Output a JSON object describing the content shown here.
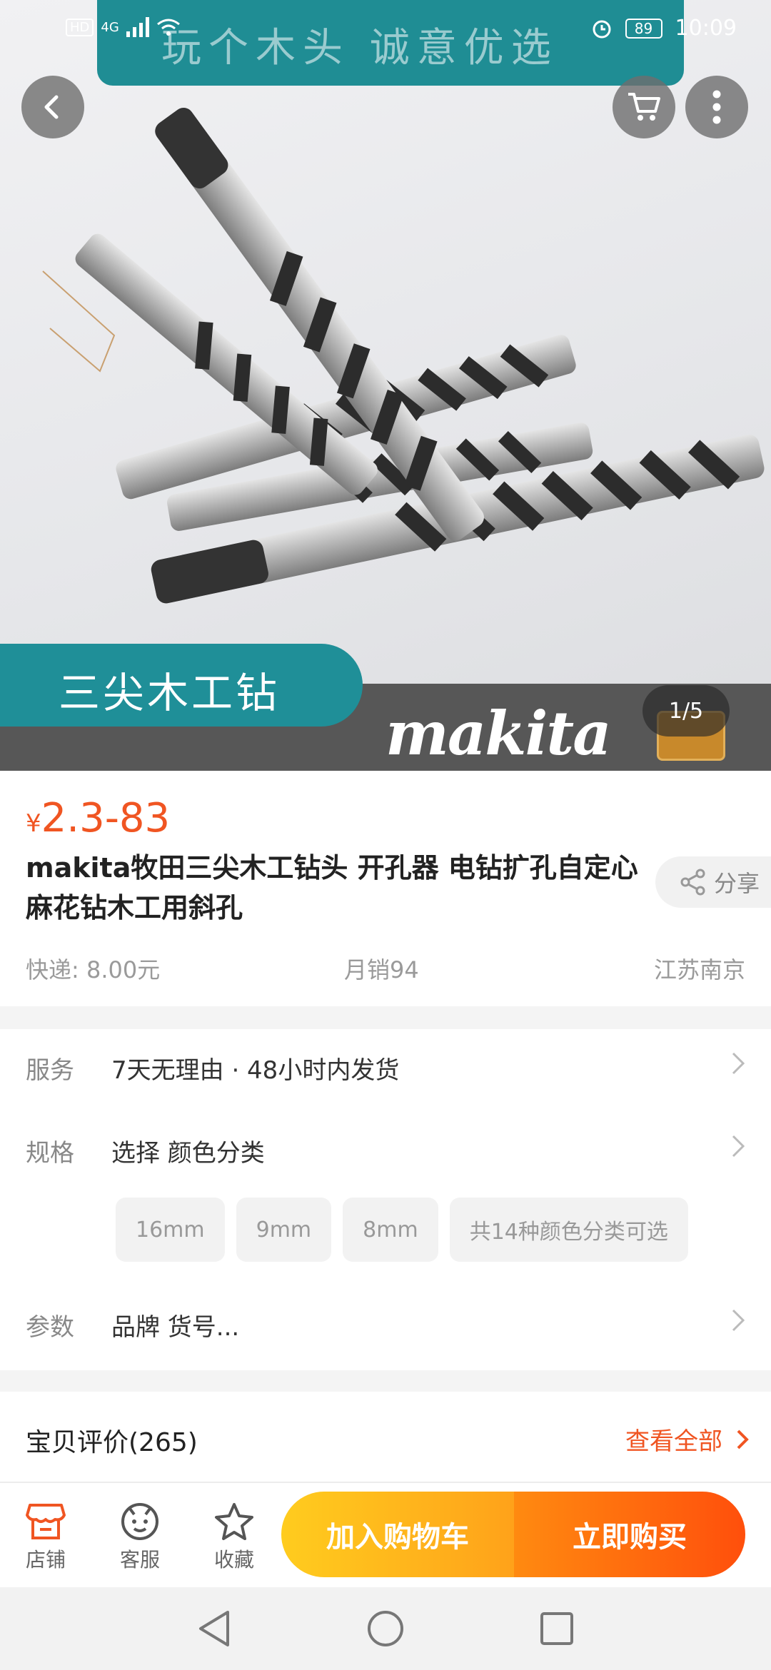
{
  "status_bar": {
    "network_hd": "HD",
    "network_4g": "4G",
    "battery": "89",
    "time": "10:09"
  },
  "hero": {
    "banner_text": "玩个木头   诚意优选",
    "tag_text": "三尖木工钻",
    "brand_logo": "makita",
    "image_counter": "1/5"
  },
  "product": {
    "currency": "¥",
    "price_range": "2.3-83",
    "title": "makita牧田三尖木工钻头 开孔器 电钻扩孔自定心麻花钻木工用斜孔",
    "share_label": "分享",
    "shipping": "快递: 8.00元",
    "monthly_sales": "月销94",
    "location": "江苏南京"
  },
  "details": {
    "service_label": "服务",
    "service_value": "7天无理由 · 48小时内发货",
    "spec_label": "规格",
    "spec_value": "选择 颜色分类",
    "spec_options": [
      "16mm",
      "9mm",
      "8mm",
      "共14种颜色分类可选"
    ],
    "params_label": "参数",
    "params_value": "品牌 货号..."
  },
  "reviews": {
    "title": "宝贝评价(265)",
    "view_all": "查看全部"
  },
  "action_bar": {
    "store": "店铺",
    "service": "客服",
    "favorite": "收藏",
    "add_to_cart": "加入购物车",
    "buy_now": "立即购买"
  },
  "colors": {
    "accent": "#f05522",
    "cart_button": "#ffb81c",
    "buy_button": "#ff5a0c",
    "teal": "#1f8f98"
  }
}
